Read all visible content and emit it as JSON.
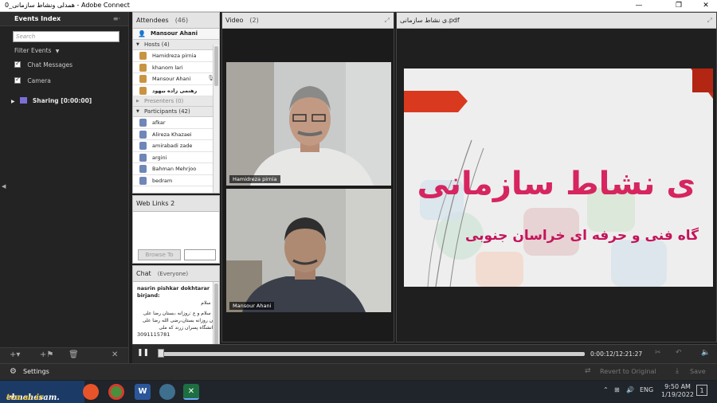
{
  "window": {
    "title": "0_همدلی ونشاط سازمانی - Adobe Connect",
    "minimize": "—",
    "maximize": "❐",
    "close": "✕"
  },
  "events": {
    "title": "Events Index",
    "menu_glyph": "≡·",
    "search_placeholder": "Search",
    "filter_label": "Filter Events",
    "chat_messages_label": "Chat Messages",
    "camera_label": "Camera",
    "sharing_label": "Sharing [0:00:00]"
  },
  "attendees": {
    "title": "Attendees",
    "count": "(46)",
    "me": "Mansour Ahani",
    "hosts_label": "Hosts (4)",
    "hosts": [
      "Hamidreza pirnia",
      "khanom lari",
      "Mansour Ahani",
      "رهنمی زاده بیهود"
    ],
    "presenters_label": "Presenters (0)",
    "participants_label": "Participants (42)",
    "participants": [
      "afkar",
      "Alireza Khazaei",
      "amirabadi zade",
      "argini",
      "Bahman Mehrjoo",
      "bedram"
    ]
  },
  "weblinks": {
    "title": "Web Links 2",
    "browse_label": "Browse To"
  },
  "chat": {
    "title": "Chat",
    "audience": "(Everyone)",
    "sender": "nasrin pishkar dokhtarar birjand:",
    "line1": "با سلام",
    "line2": "با سلام و ع :روزانه ،بستان رضا علی",
    "line3": "زن روزانه بستان،رضی الله رضا علی",
    "line4": "دانشگاه پسران زرند که ملی",
    "phone": "3091115781"
  },
  "video": {
    "title": "Video",
    "count": "(2)",
    "cam1_name": "Hamidreza pirnia",
    "cam2_name": "Mansour Ahani"
  },
  "share": {
    "title": "ی نشاط سازمانی.pdf",
    "slide_title": "ی نشاط سازمانی",
    "slide_subtitle": "گاه فنی و حرفه ای خراسان جنوبی"
  },
  "player": {
    "time": "0:00:12/12:21:27",
    "pause_glyph": "❚❚",
    "progress": 0.001
  },
  "bottom": {
    "settings_label": "Settings",
    "revert_label": "Revert to Original",
    "save_label": "Save"
  },
  "taskbar": {
    "brand_a": "ebnehesam.",
    "brand_b": "tvu.ac.ir",
    "lang": "ENG",
    "time": "9:50 AM",
    "date": "1/19/2022",
    "notif_count": "1"
  },
  "colors": {
    "accent": "#d6255f",
    "panel": "#232323",
    "slide_bg": "#efefef"
  }
}
